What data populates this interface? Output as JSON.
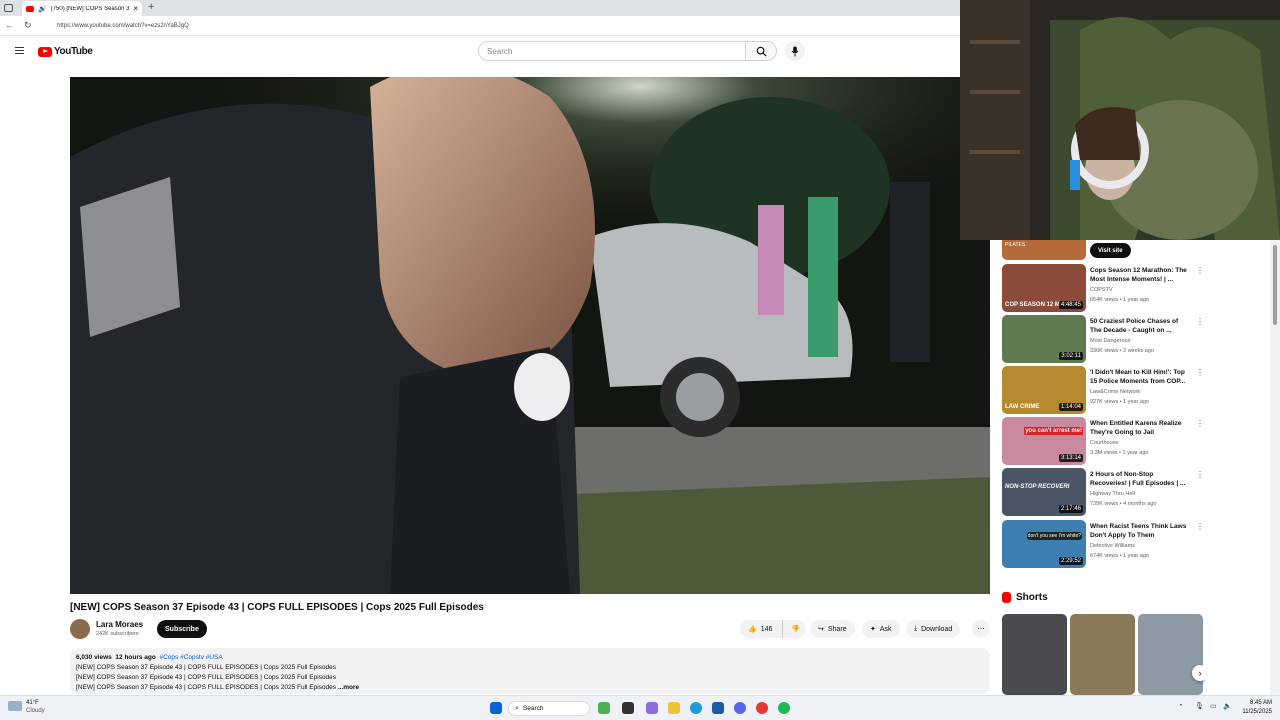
{
  "browser": {
    "tab_title": "(750) [NEW] COPS Season 37 E",
    "url": "https://www.youtube.com/watch?v=ezs2nYaBJgQ"
  },
  "youtube": {
    "logo_text": "YouTube",
    "search_placeholder": "Search"
  },
  "video": {
    "title": "[NEW] COPS Season 37 Episode 43 | COPS FULL EPISODES | Cops 2025 Full Episodes",
    "channel": "Lara Moraes",
    "subscribers": "242K subscribers",
    "subscribe_label": "Subscribe",
    "likes": "146",
    "share_label": "Share",
    "ask_label": "Ask",
    "download_label": "Download",
    "views": "6,030 views",
    "age": "12 hours ago",
    "tags": "#Cops #Copstv #USA",
    "desc_lines": [
      "[NEW] COPS Season 37 Episode 43 | COPS FULL EPISODES | Cops 2025 Full Episodes",
      "[NEW] COPS Season 37 Episode 43 | COPS FULL EPISODES | Cops 2025 Full Episodes",
      "[NEW] COPS Season 37 Episode 43 | COPS FULL EPISODES | Cops 2025 Full Episodes"
    ],
    "more_label": "...more"
  },
  "sidebar": {
    "ad_label": "PILATES",
    "visit_site_label": "Visit site",
    "recommendations": [
      {
        "title": "Cops Season 12 Marathon: The Most Intense Moments! | ...",
        "channel": "COPSTV",
        "meta": "654K views • 1 year ago",
        "duration": "4:48:45",
        "thumb_text": "COP SEASON 12 MARAT"
      },
      {
        "title": "50 Craziest Police Chases of The Decade - Caught on ...",
        "channel": "Most Dangerous",
        "meta": "336K views • 2 weeks ago",
        "duration": "3:02:11",
        "thumb_text": ""
      },
      {
        "title": "'I Didn't Mean to Kill Him!': Top 15 Police Moments from COP...",
        "channel": "Law&Crime Network",
        "meta": "927K views • 1 year ago",
        "duration": "1:14:04",
        "thumb_text": "LAW CRIME"
      },
      {
        "title": "When Entitled Karens Realize They're Going to Jail",
        "channel": "Courthouse",
        "meta": "3.3M views • 1 year ago",
        "duration": "3:13:14",
        "thumb_text": "you can't arrest me!"
      },
      {
        "title": "2 Hours of Non-Stop Recoveries! | Full Episodes | ...",
        "channel": "Highway Thru Hell",
        "meta": "735K views • 4 months ago",
        "duration": "2:17:46",
        "thumb_text": "NON-STOP RECOVERI"
      },
      {
        "title": "When Racist Teens Think Laws Don't Apply To Them",
        "channel": "Detective Williams",
        "meta": "674K views • 1 year ago",
        "duration": "2:29:52",
        "thumb_text": "don't you see I'm white?"
      }
    ],
    "shorts_label": "Shorts"
  },
  "taskbar": {
    "weather_temp": "41°F",
    "weather_desc": "Cloudy",
    "search_label": "Search",
    "time": "8:45 AM",
    "date": "11/25/2025"
  },
  "colors": {
    "youtube_red": "#ff0000",
    "accent_blue": "#065fd4"
  }
}
